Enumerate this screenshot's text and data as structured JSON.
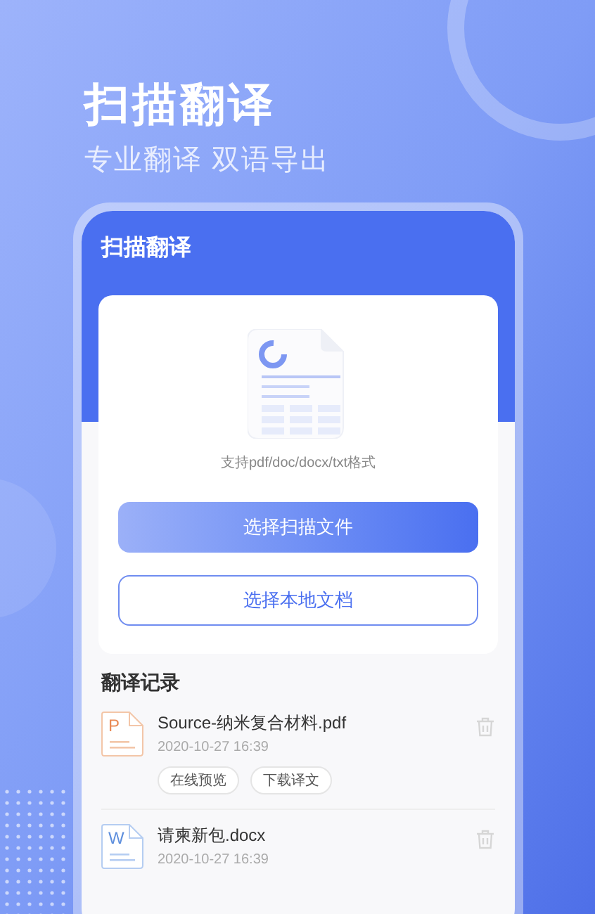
{
  "headline": "扫描翻译",
  "subheadline": "专业翻译 双语导出",
  "app": {
    "title": "扫描翻译",
    "upload": {
      "hint": "支持pdf/doc/docx/txt格式",
      "buttons": [
        {
          "label": "选择扫描文件",
          "kind": "primary"
        },
        {
          "label": "选择本地文档",
          "kind": "outline"
        }
      ]
    },
    "history": {
      "title": "翻译记录",
      "items": [
        {
          "kind": "pdf",
          "badge": "P",
          "name": "Source-纳米复合材料.pdf",
          "time": "2020-10-27 16:39",
          "actions": [
            "在线预览",
            "下载译文"
          ]
        },
        {
          "kind": "word",
          "badge": "W",
          "name": "请柬新包.docx",
          "time": "2020-10-27 16:39"
        }
      ]
    }
  }
}
